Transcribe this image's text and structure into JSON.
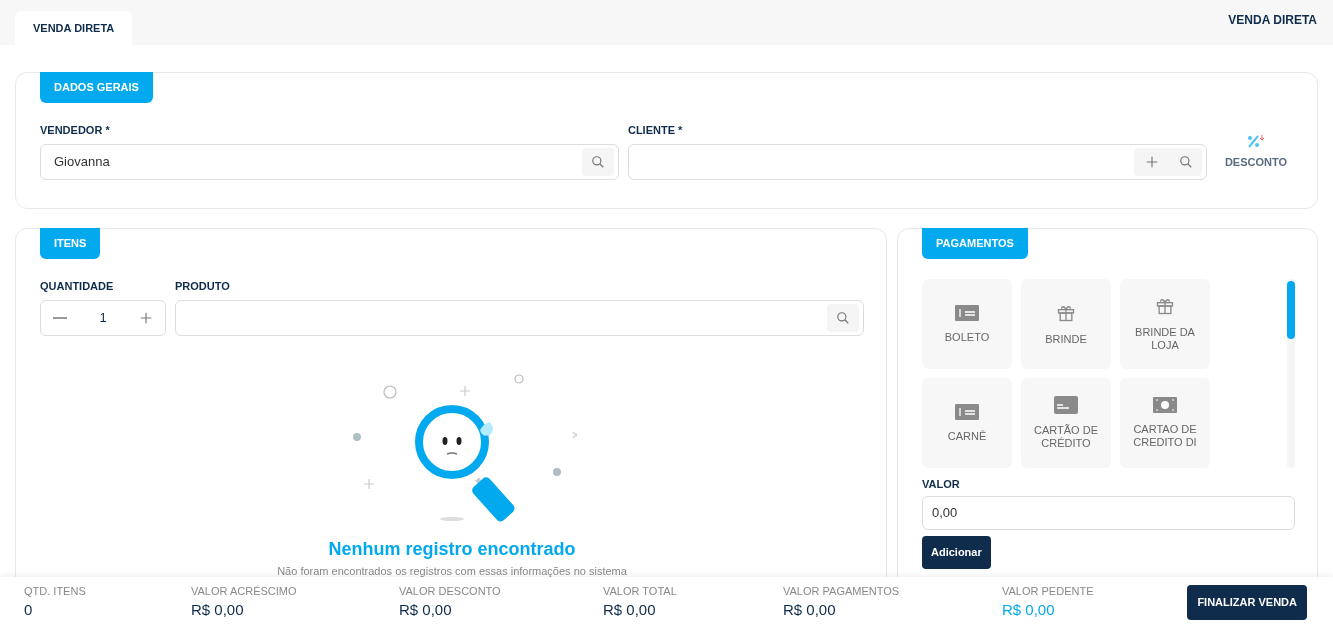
{
  "tabs": [
    {
      "label": "VENDA DIRETA",
      "selected": true
    }
  ],
  "page_title": "VENDA DIRETA",
  "general": {
    "title": "DADOS GERAIS",
    "seller": {
      "label": "VENDEDOR *",
      "value": "Giovanna"
    },
    "client": {
      "label": "CLIENTE *"
    },
    "discount": {
      "label": "DESCONTO"
    }
  },
  "items": {
    "title": "ITENS",
    "quantity": {
      "label": "QUANTIDADE",
      "value": "1"
    },
    "product": {
      "label": "PRODUTO"
    },
    "empty": {
      "title": "Nenhum registro encontrado",
      "message": "Não foram encontrados os registros com essas informações no sistema"
    }
  },
  "payments": {
    "title": "PAGAMENTOS",
    "methods": [
      {
        "label": "BOLETO",
        "kind": "bill"
      },
      {
        "label": "BRINDE",
        "kind": "gift"
      },
      {
        "label": "BRINDE DA LOJA",
        "kind": "gift"
      },
      {
        "label": "CARNÊ",
        "kind": "bill"
      },
      {
        "label": "CARTÃO DE CRÉDITO",
        "kind": "card"
      },
      {
        "label": "CARTAO DE CREDITO DI",
        "kind": "cash"
      }
    ],
    "value": {
      "label": "VALOR",
      "value": "0,00"
    },
    "add_button": "Adicionar"
  },
  "totals": [
    {
      "label": "QTD. ITENS",
      "value": "0",
      "highlight": false
    },
    {
      "label": "VALOR ACRÉSCIMO",
      "value": "R$ 0,00",
      "highlight": false
    },
    {
      "label": "VALOR DESCONTO",
      "value": "R$ 0,00",
      "highlight": false
    },
    {
      "label": "VALOR TOTAL",
      "value": "R$ 0,00",
      "highlight": false
    },
    {
      "label": "VALOR PAGAMENTOS",
      "value": "R$ 0,00",
      "highlight": false
    },
    {
      "label": "VALOR PEDENTE",
      "value": "R$ 0,00",
      "highlight": true
    }
  ],
  "finish_button": "FINALIZAR VENDA"
}
